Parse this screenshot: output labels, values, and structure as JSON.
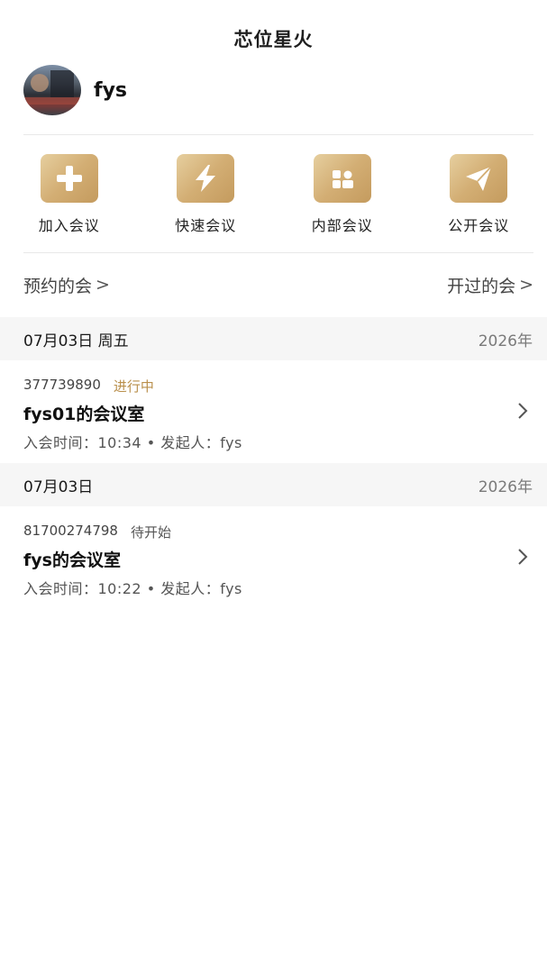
{
  "header": {
    "title": "芯位星火"
  },
  "profile": {
    "username": "fys"
  },
  "actions": [
    {
      "label": "加入会议",
      "icon": "plus-icon"
    },
    {
      "label": "快速会议",
      "icon": "lightning-icon"
    },
    {
      "label": "内部会议",
      "icon": "building-icon"
    },
    {
      "label": "公开会议",
      "icon": "paper-plane-icon"
    }
  ],
  "sections": {
    "scheduled": "预约的会",
    "past": "开过的会",
    "chevron": ">"
  },
  "groups": [
    {
      "date": "07月03日 周五",
      "year": "2026年",
      "meeting": {
        "id": "377739890",
        "status": "进行中",
        "status_color": "#b98f4b",
        "name": "fys01的会议室",
        "meta": "入会时间：10:34  •  发起人：fys"
      }
    },
    {
      "date": "07月03日",
      "year": "2026年",
      "meeting": {
        "id": "81700274798",
        "status": "待开始",
        "status_color": "#555555",
        "name": "fys的会议室",
        "meta": "入会时间：10:22  •  发起人：fys"
      }
    }
  ],
  "theme": {
    "accent_gold": "#d3ae74",
    "band_bg": "#f6f6f6"
  }
}
